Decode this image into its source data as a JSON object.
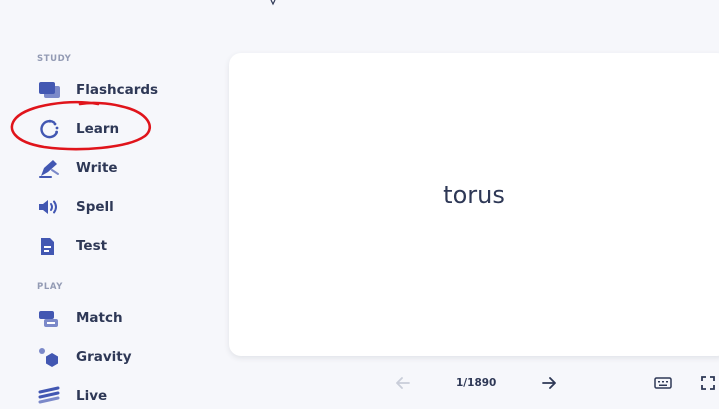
{
  "sidebar": {
    "study_label": "STUDY",
    "play_label": "PLAY",
    "study_items": [
      {
        "label": "Flashcards",
        "icon": "flashcards-icon"
      },
      {
        "label": "Learn",
        "icon": "learn-icon"
      },
      {
        "label": "Write",
        "icon": "write-icon"
      },
      {
        "label": "Spell",
        "icon": "spell-icon"
      },
      {
        "label": "Test",
        "icon": "test-icon"
      }
    ],
    "play_items": [
      {
        "label": "Match",
        "icon": "match-icon"
      },
      {
        "label": "Gravity",
        "icon": "gravity-icon"
      },
      {
        "label": "Live",
        "icon": "live-icon"
      }
    ]
  },
  "card": {
    "term": "torus"
  },
  "controls": {
    "counter": "1/1890",
    "prev_icon": "arrow-left-icon",
    "next_icon": "arrow-right-icon",
    "keyboard_icon": "keyboard-icon",
    "fullscreen_icon": "fullscreen-icon"
  },
  "colors": {
    "accent": "#4257b2",
    "accent_light": "#7b89c9",
    "annotation": "#e0141b",
    "background": "#f6f7fb"
  }
}
